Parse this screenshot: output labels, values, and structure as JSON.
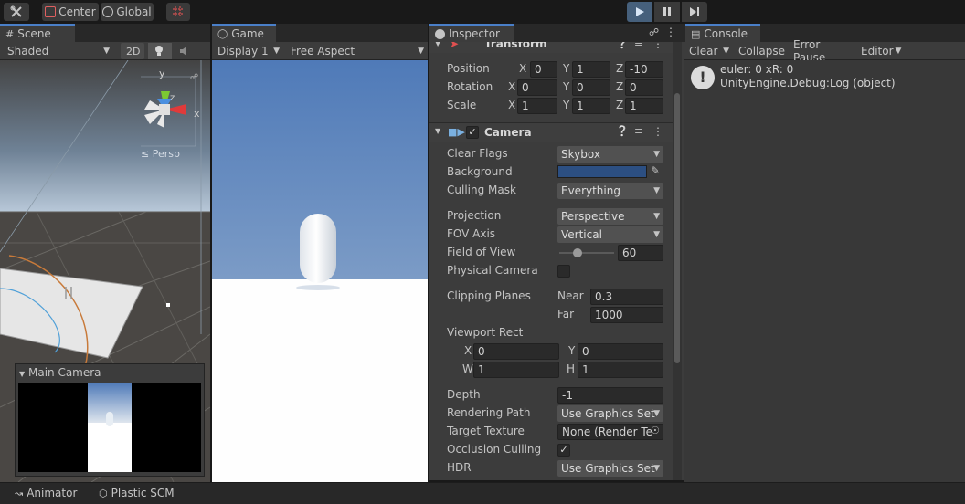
{
  "toolbar": {
    "center_label": "Center",
    "global_label": "Global",
    "play_icon": "play-icon",
    "pause_icon": "pause-icon",
    "step_icon": "step-icon"
  },
  "scene": {
    "tab_label": "Scene",
    "shading_mode": "Shaded",
    "mode_2d_label": "2D",
    "gizmo_axes": {
      "y": "y",
      "z": "z",
      "x": "x"
    },
    "persp_label": "≤ Persp",
    "camera_preview_title": "Main Camera"
  },
  "game": {
    "tab_label": "Game",
    "display_label": "Display 1",
    "aspect_label": "Free Aspect"
  },
  "inspector": {
    "tab_label": "Inspector",
    "transform": {
      "title": "Transform",
      "position": {
        "label": "Position",
        "x": "0",
        "y": "1",
        "z": "-10"
      },
      "rotation": {
        "label": "Rotation",
        "x": "0",
        "y": "0",
        "z": "0"
      },
      "scale": {
        "label": "Scale",
        "x": "1",
        "y": "1",
        "z": "1"
      }
    },
    "camera": {
      "title": "Camera",
      "enabled": true,
      "clear_flags": {
        "label": "Clear Flags",
        "value": "Skybox"
      },
      "background": {
        "label": "Background",
        "color": "#2c4f82"
      },
      "culling_mask": {
        "label": "Culling Mask",
        "value": "Everything"
      },
      "projection": {
        "label": "Projection",
        "value": "Perspective"
      },
      "fov_axis": {
        "label": "FOV Axis",
        "value": "Vertical"
      },
      "field_of_view": {
        "label": "Field of View",
        "value": "60",
        "slider_fraction": 0.33
      },
      "physical_camera": {
        "label": "Physical Camera",
        "checked": false
      },
      "clipping_planes": {
        "label": "Clipping Planes",
        "near_label": "Near",
        "near": "0.3",
        "far_label": "Far",
        "far": "1000"
      },
      "viewport_rect": {
        "label": "Viewport Rect",
        "x_label": "X",
        "x": "0",
        "y_label": "Y",
        "y": "0",
        "w_label": "W",
        "w": "1",
        "h_label": "H",
        "h": "1"
      },
      "depth": {
        "label": "Depth",
        "value": "-1"
      },
      "rendering_path": {
        "label": "Rendering Path",
        "value": "Use Graphics Set"
      },
      "target_texture": {
        "label": "Target Texture",
        "value": "None (Render Te"
      },
      "occlusion_culling": {
        "label": "Occlusion Culling",
        "checked": true
      },
      "hdr": {
        "label": "HDR",
        "value": "Use Graphics Set"
      }
    },
    "axis_x": "X",
    "axis_y": "Y",
    "axis_z": "Z"
  },
  "console": {
    "tab_label": "Console",
    "clear_label": "Clear",
    "collapse_label": "Collapse",
    "error_pause_label": "Error Pause",
    "editor_label": "Editor",
    "log_line1": "euler: 0 xR: 0",
    "log_line2": "UnityEngine.Debug:Log (object)"
  },
  "bottom": {
    "animator_label": "Animator",
    "plastic_label": "Plastic SCM"
  },
  "colors": {
    "accent": "#4a7fc8",
    "play_active_bg": "#46607c",
    "skybox_top": "#4f7ab8",
    "ground": "#fefefe"
  }
}
